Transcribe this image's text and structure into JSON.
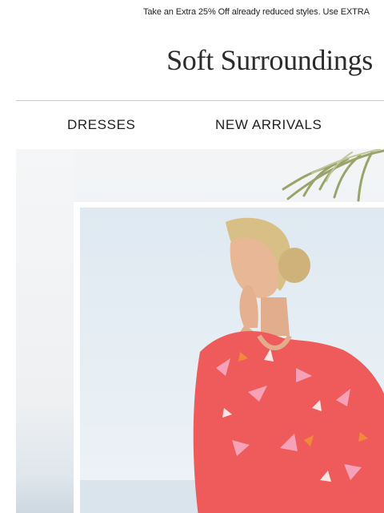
{
  "promo": {
    "text": "Take an Extra 25% Off already reduced styles. Use EXTRA"
  },
  "brand": {
    "logo_text": "Soft Surroundings"
  },
  "nav": {
    "items": [
      {
        "label": "DRESSES"
      },
      {
        "label": "NEW ARRIVALS"
      }
    ]
  },
  "hero": {
    "image_subject": "woman in coral tropical print dress",
    "colors": {
      "dress_coral": "#ef5a5a",
      "dress_pink": "#f7a1b8",
      "sky": "#e3ecf3"
    }
  }
}
